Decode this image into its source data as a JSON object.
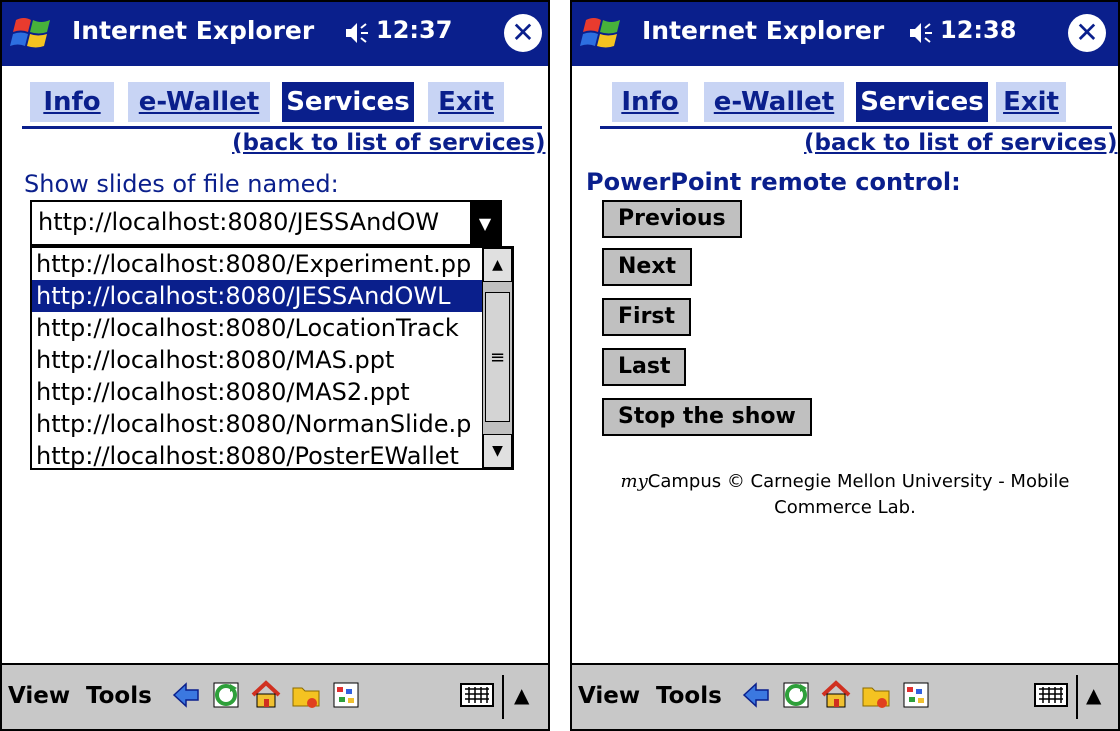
{
  "left_screen": {
    "titlebar": {
      "title": "Internet Explorer",
      "time": "12:37",
      "close_label": "✕"
    },
    "tabs": [
      "Info",
      "e-Wallet",
      "Services",
      "Exit"
    ],
    "back_link": "(back to list of services)",
    "show_label": "Show slides of file named:",
    "select": {
      "value": "http://localhost:8080/JESSAndOW",
      "options": [
        "http://localhost:8080/Experiment.pp",
        "http://localhost:8080/JESSAndOWL",
        "http://localhost:8080/LocationTrack",
        "http://localhost:8080/MAS.ppt",
        "http://localhost:8080/MAS2.ppt",
        "http://localhost:8080/NormanSlide.p",
        "http://localhost:8080/PosterEWallet"
      ],
      "selected_index": 1
    },
    "bottom_menu": {
      "view": "View",
      "tools": "Tools"
    }
  },
  "right_screen": {
    "titlebar": {
      "title": "Internet Explorer",
      "time": "12:38",
      "close_label": "✕"
    },
    "tabs": [
      "Info",
      "e-Wallet",
      "Services",
      "Exit"
    ],
    "back_link": "(back to list of services)",
    "section_title": "PowerPoint remote control:",
    "buttons": [
      "Previous",
      "Next",
      "First",
      "Last",
      "Stop the show"
    ],
    "footer": {
      "my": "my",
      "line1": "Campus © Carnegie Mellon University - Mobile",
      "line2": "Commerce Lab."
    },
    "bottom_menu": {
      "view": "View",
      "tools": "Tools"
    }
  },
  "colors": {
    "accent": "#0a1f8c",
    "tab_bg": "#c8d4f4",
    "button_bg": "#c0c0c0",
    "toolbar_bg": "#c8c8c8"
  },
  "icons": [
    "windows-logo-icon",
    "speaker-icon",
    "close-icon",
    "back-arrow-icon",
    "refresh-icon",
    "home-icon",
    "favorites-folder-icon",
    "view-icon",
    "keyboard-icon",
    "up-arrow-icon"
  ]
}
